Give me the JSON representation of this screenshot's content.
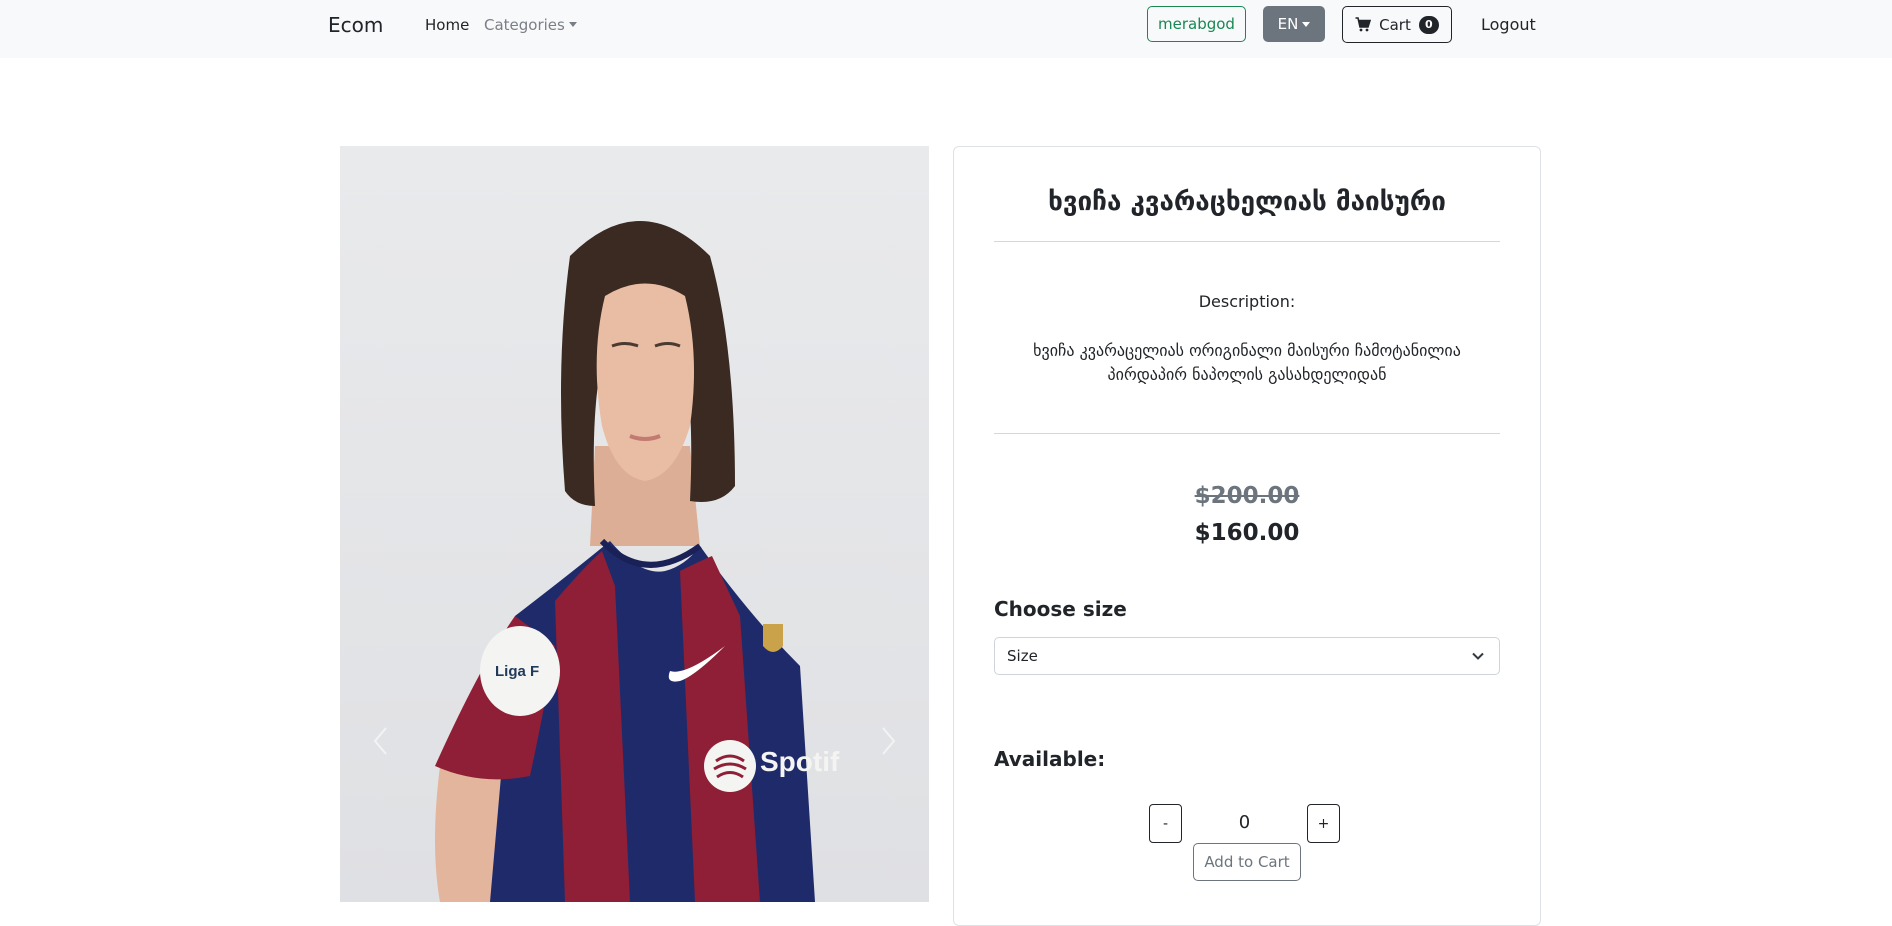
{
  "navbar": {
    "brand": "Ecom",
    "home": "Home",
    "categories": "Categories",
    "user": "merabgod",
    "language": "EN",
    "cart_label": "Cart",
    "cart_count": "0",
    "logout": "Logout"
  },
  "carousel": {
    "prev_icon": "chevron-left-icon",
    "next_icon": "chevron-right-icon"
  },
  "product": {
    "title": "ხვიჩა კვარაცხელიას მაისური",
    "description_label": "Description:",
    "description": "ხვიჩა კვარაცელიას ორიგინალი მაისური ჩამოტანილია პირდაპირ ნაპოლის გასახდელიდან",
    "price_old": "$200.00",
    "price_new": "$160.00",
    "choose_size_label": "Choose size",
    "size_selected": "Size",
    "available_label": "Available:",
    "qty_minus": "-",
    "qty_value": "0",
    "qty_plus": "+",
    "add_to_cart": "Add to Cart"
  },
  "colors": {
    "navbar_bg": "#f8f9fa",
    "success": "#198754",
    "secondary": "#6c757d",
    "dark": "#212529",
    "jersey_blue": "#1f2a6b",
    "jersey_red": "#8e1f36"
  }
}
